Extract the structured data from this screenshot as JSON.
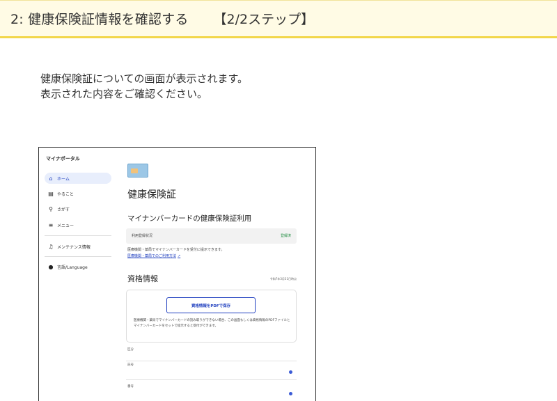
{
  "header": {
    "title": "2: 健康保険証情報を確認する",
    "progress": "【2/2ステップ】"
  },
  "intro": {
    "line1": "健康保険証についての画面が表示されます。",
    "line2": "表示された内容をご確認ください。"
  },
  "screenshot": {
    "brand": "マイナポータル",
    "nav": [
      {
        "label": "ホーム",
        "icon": "home-icon"
      },
      {
        "label": "やること",
        "icon": "clipboard-icon"
      },
      {
        "label": "さがす",
        "icon": "search-icon"
      },
      {
        "label": "メニュー",
        "icon": "menu-icon"
      },
      {
        "label": "メンテナンス情報",
        "icon": "bell-icon"
      },
      {
        "label": "言語/Language",
        "icon": "globe-icon"
      }
    ],
    "page_title": "健康保険証",
    "section_title": "マイナンバーカードの健康保険証利用",
    "status_label": "利用登録状況",
    "status_value": "登録済",
    "note": "医療機関・薬局でマイナンバーカードを受付に提示できます。",
    "note_link": "医療機関・薬局でのご利用方法",
    "qualification_title": "資格情報",
    "as_of": "令和7年3月31日時点",
    "pdf_button": "資格情報をPDFで保存",
    "pdf_text": "医療機関・薬局でマイナンバーカードの読み取りができない場合、この画面もしくは資格情報のPDFファイルとマイナンバーカードをセットで提示すると受付ができます。",
    "fields": [
      "区分",
      "記号",
      "番号"
    ]
  },
  "colors": {
    "header_bg": "#fffbe5",
    "header_border": "#f2d64a",
    "accent": "#1f3fbf"
  }
}
